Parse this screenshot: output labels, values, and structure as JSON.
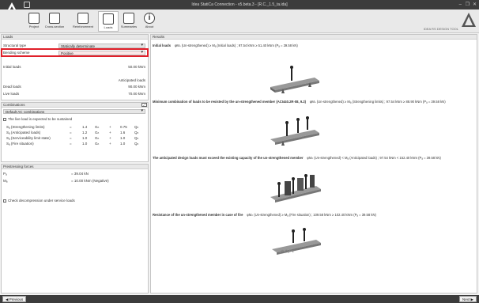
{
  "app": {
    "title": "Idea StatiCa Connection - v5.beta.3 - [R.C._1.5_ta.ida]"
  },
  "window": {
    "minimize": "–",
    "restore": "❐",
    "close": "✕"
  },
  "ribbon": {
    "items": [
      {
        "label": "Project"
      },
      {
        "label": "Cross-section"
      },
      {
        "label": "Reinforcement"
      },
      {
        "label": "Loads"
      },
      {
        "label": "Summaries"
      },
      {
        "label": "About"
      }
    ],
    "brand": "IDEA RS DESIGN TOOL"
  },
  "loads": {
    "header": "Loads",
    "structural_type_label": "Structural type",
    "structural_type_value": "Statically determinate",
    "bending_scheme_label": "Bending scheme",
    "bending_scheme_value": "Positive",
    "initial_loads_label": "Initial loads",
    "initial_loads_value": "50.00  kNm",
    "anticipated_header": "Anticipated loads",
    "dead_loads_label": "Dead loads",
    "dead_loads_value": "90.00  kNm",
    "live_loads_label": "Live loads",
    "live_loads_value": "70.00  kNm"
  },
  "combinations": {
    "header": "Combinations",
    "select_value": "Default AC combinations",
    "sustained_label": "The live load is expected to be sustained",
    "rows": [
      {
        "name": "Sₐ (Strengthening limits)",
        "c1": "1.4",
        "g": "Gₙ",
        "c2": "0.75",
        "q": "Qₙ"
      },
      {
        "name": "Sₐ (Anticipated loads)",
        "c1": "1.2",
        "g": "Gₙ",
        "c2": "1.6",
        "q": "Qₙ"
      },
      {
        "name": "Sₐ (Serviceability limit state)",
        "c1": "1.0",
        "g": "Gₙ",
        "c2": "1.0",
        "q": "Qₙ"
      },
      {
        "name": "Sₐ (Fire situation)",
        "c1": "1.0",
        "g": "Gₙ",
        "c2": "1.0",
        "q": "Qₙ"
      }
    ]
  },
  "prestress": {
    "header": "Prestressing forces",
    "p_label": "Pₐ",
    "p_value": "= 39.04  kN",
    "m_label": "Mₐ",
    "m_value": "= 10.00  kNm (Negative)",
    "check_label": "Check decompression under service loads"
  },
  "results": {
    "header": "Results",
    "items": [
      {
        "title": "Initial loads",
        "formula": "φMₙ (Un-strengthened) ≥ Mₐ (Initial loads) ;  97.54 kNm ≥ 51.40 kNm (Pₐ = 39.58 kN)"
      },
      {
        "title": "Minimum combination of loads to be resisted by the un-strengthened member (ACI440.2R-08, 9.2)",
        "formula": "φMₙ (Un-strengthened) ≥ Mₐ (Strengthening limits) ;  97.54 kNm ≥ 88.90 kNm (Pₐ = 39.58 kN)"
      },
      {
        "title": "The anticipated design loads must exceed the existing capacity of the un-strengthened member",
        "formula": "φMₙ (Un-strengthened) < Mₐ (Anticipated loads) ;  97.54 kNm < 152.40 kNm (Pₐ = 39.58 kN)"
      },
      {
        "title": "Resistance of the un-strengthened member in case of fire",
        "formula": "φMₙ (Un-strengthened) ≥ Mₐ (Fire situation) ;  109.58 kNm ≥ 102.40 kNm (Pₐ = 39.58 kN)"
      }
    ]
  },
  "nav": {
    "previous": "Previous",
    "next": "Next"
  },
  "colors": {
    "highlight": "#e0202a",
    "titlebar": "#3c3c3c"
  }
}
